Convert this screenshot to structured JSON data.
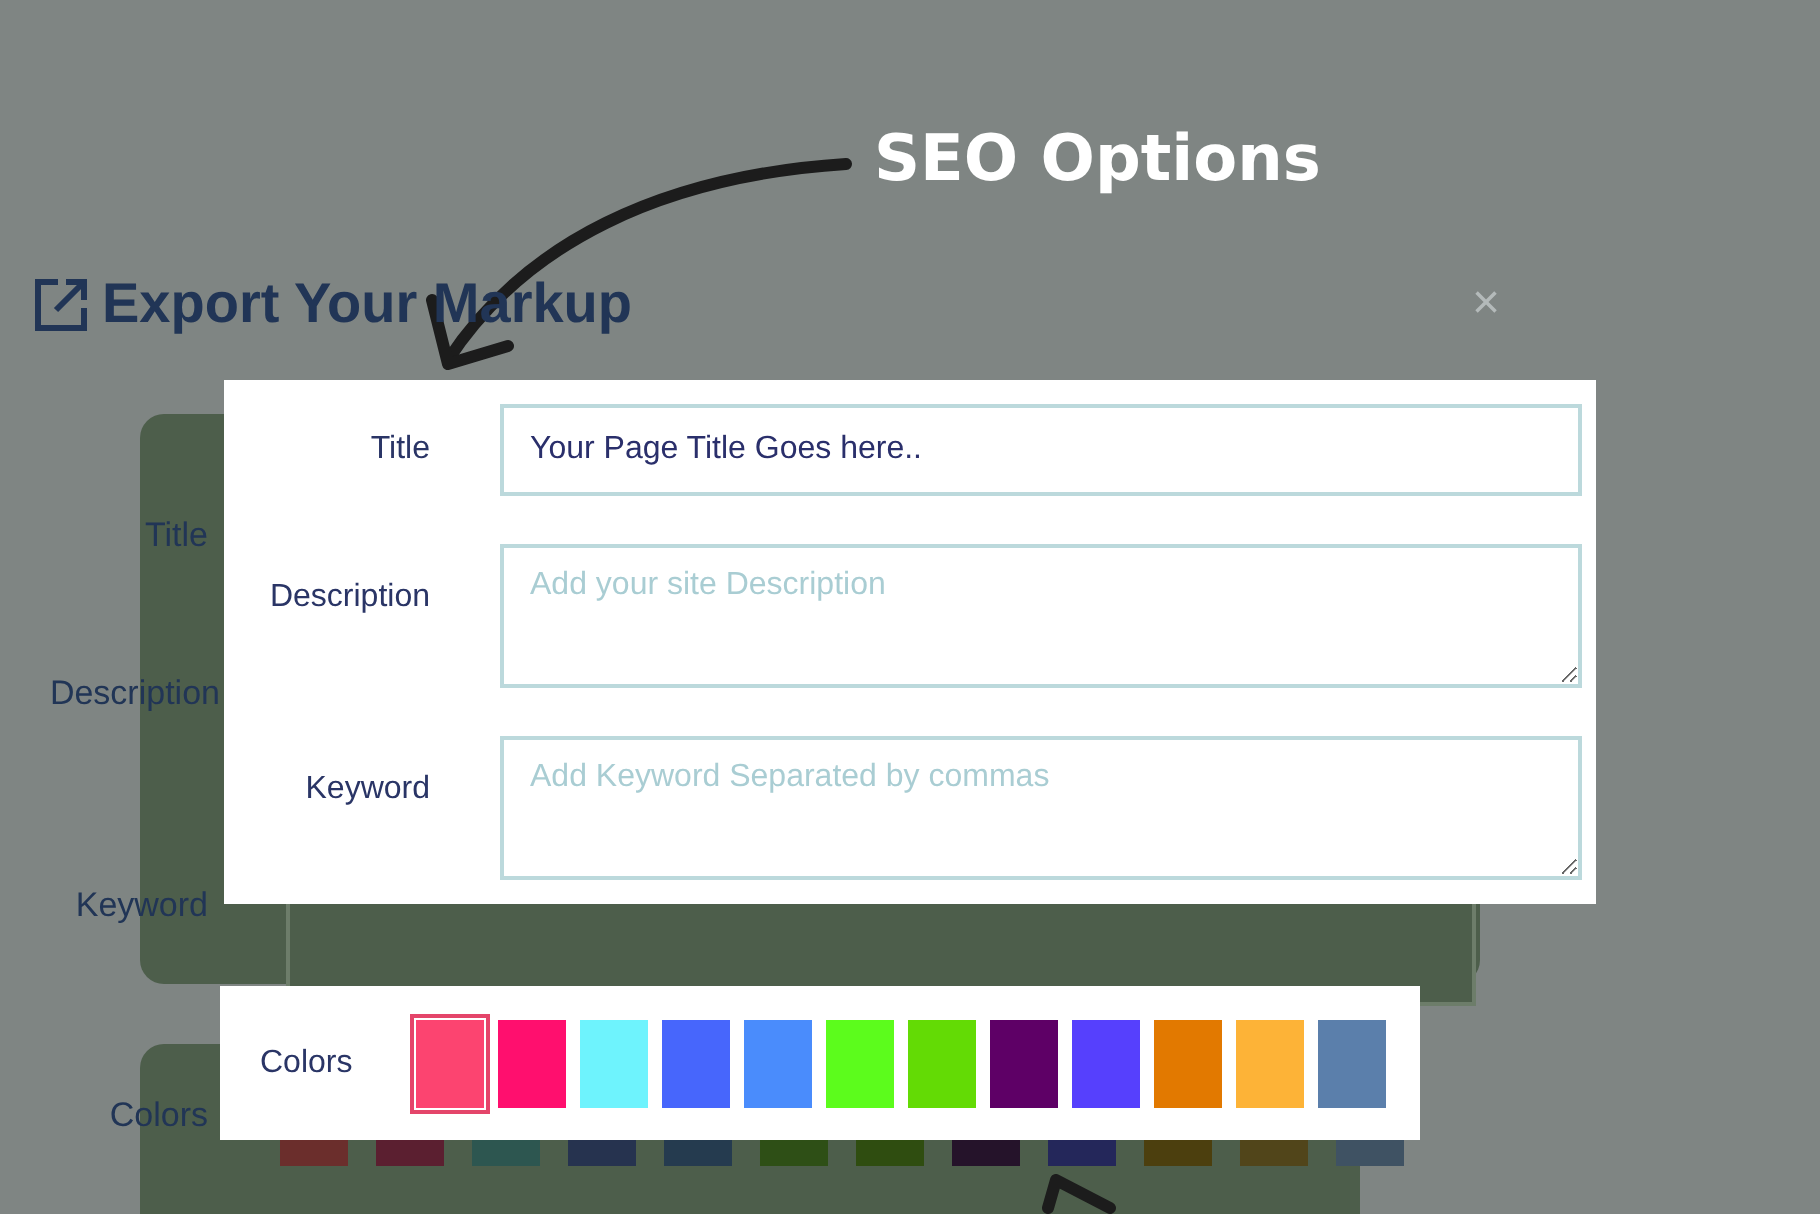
{
  "annotation": {
    "heading": "SEO Options"
  },
  "background_dialog": {
    "title": "Export Your Markup",
    "close": "×",
    "labels": [
      "Title",
      "Description",
      "Keyword",
      "Colors"
    ],
    "swatches": [
      {
        "color": "#6b2e2c"
      },
      {
        "color": "#5b1f30"
      },
      {
        "color": "#2d5650"
      },
      {
        "color": "#26334f"
      },
      {
        "color": "#253b4f"
      },
      {
        "color": "#2e4f16"
      },
      {
        "color": "#2f4d10"
      },
      {
        "color": "#25132a"
      },
      {
        "color": "#24275a"
      },
      {
        "color": "#4c3f0e"
      },
      {
        "color": "#51451a"
      },
      {
        "color": "#3f5263"
      }
    ]
  },
  "seo_panel": {
    "fields": [
      {
        "label": "Title",
        "kind": "input",
        "value": "Your Page Title Goes here.."
      },
      {
        "label": "Description",
        "kind": "textarea",
        "placeholder": "Add your site Description"
      },
      {
        "label": "Keyword",
        "kind": "textarea",
        "placeholder": "Add Keyword Separated by commas"
      }
    ]
  },
  "colors_panel": {
    "label": "Colors",
    "swatches": [
      {
        "color": "#fc4470",
        "selected": true
      },
      {
        "color": "#ff0f6e",
        "selected": false
      },
      {
        "color": "#6ef3fd",
        "selected": false
      },
      {
        "color": "#4766fc",
        "selected": false
      },
      {
        "color": "#4a8cfc",
        "selected": false
      },
      {
        "color": "#5cfc1c",
        "selected": false
      },
      {
        "color": "#63db05",
        "selected": false
      },
      {
        "color": "#5e0066",
        "selected": false
      },
      {
        "color": "#5640fd",
        "selected": false
      },
      {
        "color": "#e27900",
        "selected": false
      },
      {
        "color": "#fdb337",
        "selected": false
      },
      {
        "color": "#5b7fab",
        "selected": false
      }
    ]
  }
}
